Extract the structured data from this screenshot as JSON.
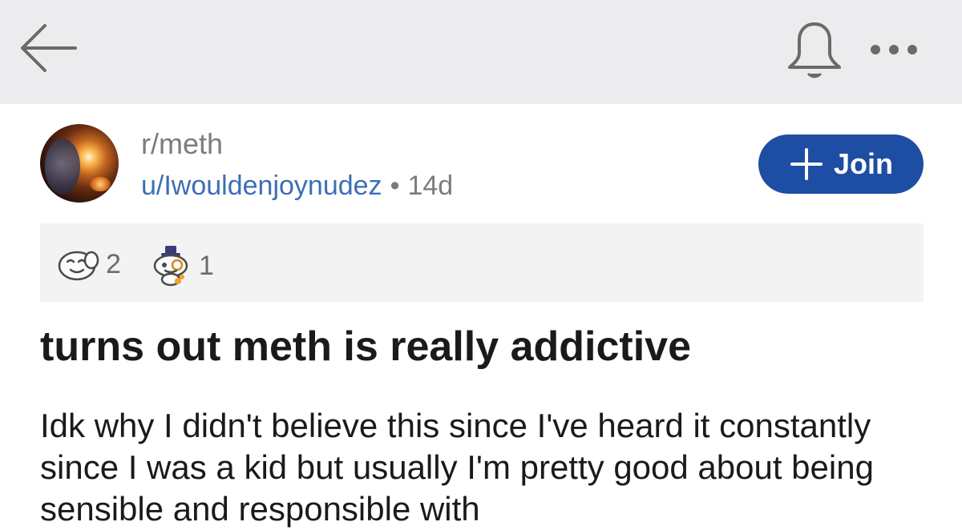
{
  "header": {
    "back_icon": "arrow-left-icon",
    "bell_icon": "bell-icon",
    "more_icon": "ellipsis-icon"
  },
  "post": {
    "subreddit": "r/meth",
    "username": "u/Iwouldenjoynudez",
    "separator": "•",
    "age": "14d",
    "join_label": "Join",
    "join_icon": "plus-icon",
    "awards": [
      {
        "icon": "award-face-icon",
        "count": "2"
      },
      {
        "icon": "award-snoo-monocle-icon",
        "count": "1"
      }
    ],
    "title": "turns out meth is really addictive",
    "body": "Idk why I didn't believe this since I've heard it constantly since I was a kid but usually I'm pretty good about being sensible and responsible with"
  },
  "colors": {
    "header_bg": "#ececee",
    "join_button": "#1e4ea3",
    "username_link": "#3b6fb6",
    "muted_text": "#7c7c7c",
    "awards_bg": "#f3f3f4"
  }
}
